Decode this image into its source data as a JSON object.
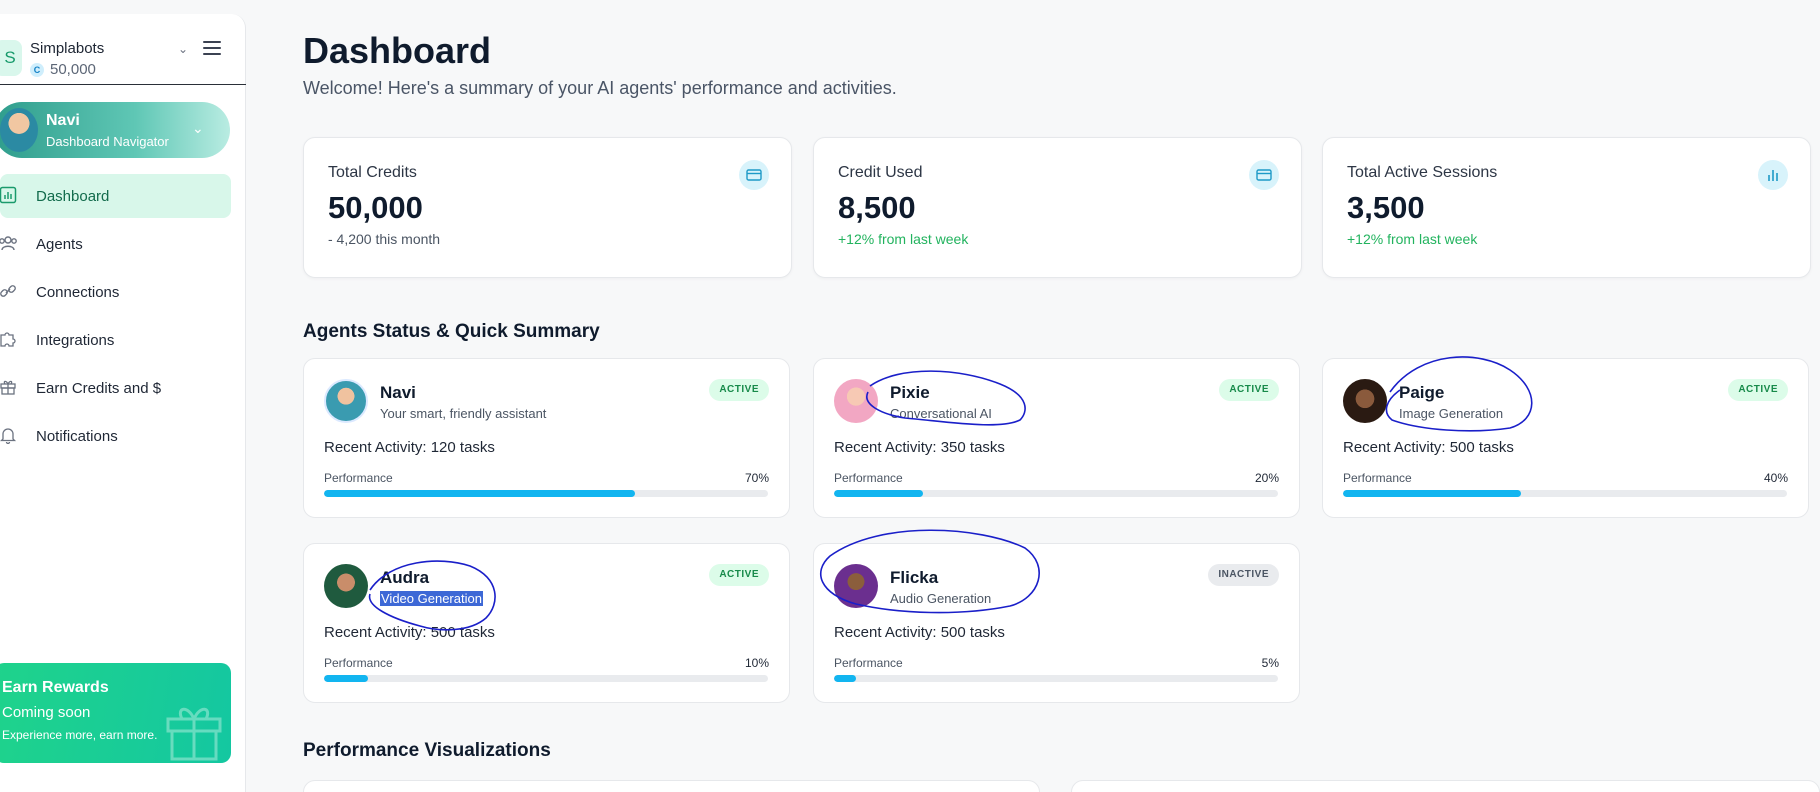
{
  "sidebar": {
    "workspace": {
      "initial": "S",
      "name": "Simplabots",
      "coin": "C",
      "credits": "50,000"
    },
    "navigator": {
      "name": "Navi",
      "subtitle": "Dashboard Navigator"
    },
    "items": [
      {
        "label": "Dashboard",
        "icon": "bar-chart-icon",
        "active": true
      },
      {
        "label": "Agents",
        "icon": "users-icon",
        "active": false
      },
      {
        "label": "Connections",
        "icon": "link-icon",
        "active": false
      },
      {
        "label": "Integrations",
        "icon": "puzzle-icon",
        "active": false
      },
      {
        "label": "Earn Credits and $",
        "icon": "gift-icon",
        "active": false
      },
      {
        "label": "Notifications",
        "icon": "bell-icon",
        "active": false
      }
    ],
    "rewards": {
      "title": "Earn Rewards",
      "subtitle": "Coming soon",
      "description": "Experience more, earn more."
    }
  },
  "header": {
    "title": "Dashboard",
    "subtitle": "Welcome! Here's a summary of your AI agents' performance and activities."
  },
  "stats": [
    {
      "label": "Total Credits",
      "value": "50,000",
      "note": "- 4,200 this month",
      "note_color": "#4b5563",
      "icon": "credit-card-icon"
    },
    {
      "label": "Credit Used",
      "value": "8,500",
      "note": "+12% from last week",
      "note_color": "#22b35e",
      "icon": "credit-card-icon"
    },
    {
      "label": "Total Active Sessions",
      "value": "3,500",
      "note": "+12% from last week",
      "note_color": "#22b35e",
      "icon": "bar-chart-icon"
    }
  ],
  "agents_section": {
    "title": "Agents Status & Quick Summary"
  },
  "agents": [
    {
      "name": "Navi",
      "role": "Your smart, friendly assistant",
      "status": "ACTIVE",
      "activity": "Recent Activity: 120 tasks",
      "perf_label": "Performance",
      "perf_text": "70%",
      "perf": 0.7
    },
    {
      "name": "Pixie",
      "role": "Conversational AI",
      "status": "ACTIVE",
      "activity": "Recent Activity: 350 tasks",
      "perf_label": "Performance",
      "perf_text": "20%",
      "perf": 0.2
    },
    {
      "name": "Paige",
      "role": "Image Generation",
      "status": "ACTIVE",
      "activity": "Recent Activity: 500 tasks",
      "perf_label": "Performance",
      "perf_text": "40%",
      "perf": 0.4
    },
    {
      "name": "Audra",
      "role": "Video Generation",
      "status": "ACTIVE",
      "activity": "Recent Activity: 500 tasks",
      "perf_label": "Performance",
      "perf_text": "10%",
      "perf": 0.1
    },
    {
      "name": "Flicka",
      "role": "Audio Generation",
      "status": "INACTIVE",
      "activity": "Recent Activity: 500 tasks",
      "perf_label": "Performance",
      "perf_text": "5%",
      "perf": 0.05
    }
  ],
  "viz_section": {
    "title": "Performance Visualizations"
  },
  "colors": {
    "accent": "#12b5f0",
    "brand": "#1fd38b",
    "annotation": "#1a1fc9"
  }
}
